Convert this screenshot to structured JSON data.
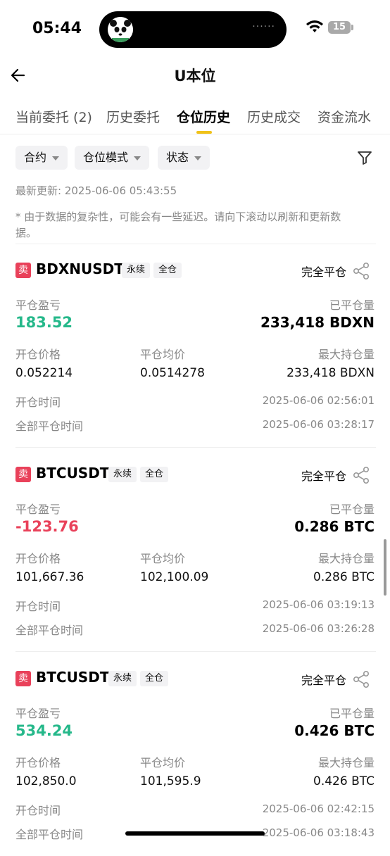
{
  "status_bar": {
    "time": "05:44",
    "battery": "15",
    "dots": "······"
  },
  "header": {
    "title": "U本位"
  },
  "tabs": [
    {
      "label": "当前委托 (2)"
    },
    {
      "label": "历史委托"
    },
    {
      "label": "仓位历史"
    },
    {
      "label": "历史成交"
    },
    {
      "label": "资金流水"
    }
  ],
  "filters": [
    {
      "label": "合约"
    },
    {
      "label": "仓位模式"
    },
    {
      "label": "状态"
    }
  ],
  "last_updated": "最新更新: 2025-06-06 05:43:55",
  "note": "* 由于数据的复杂性，可能会有一些延迟。请向下滚动以刷新和更新数据。",
  "labels": {
    "pnl": "平仓盈亏",
    "closed_qty": "已平仓量",
    "open_price": "开仓价格",
    "avg_close_price": "平仓均价",
    "max_holding": "最大持仓量",
    "open_time": "开仓时间",
    "full_close_time": "全部平仓时间"
  },
  "positions": [
    {
      "side": "卖",
      "symbol": "BDXNUSDT",
      "type": "永续",
      "margin": "全仓",
      "status": "完全平仓",
      "pnl": "183.52",
      "pnl_sign": "positive",
      "closed_qty": "233,418 BDXN",
      "open_price": "0.052214",
      "avg_close_price": "0.0514278",
      "max_holding": "233,418 BDXN",
      "open_time": "2025-06-06 02:56:01",
      "full_close_time": "2025-06-06 03:28:17"
    },
    {
      "side": "卖",
      "symbol": "BTCUSDT",
      "type": "永续",
      "margin": "全仓",
      "status": "完全平仓",
      "pnl": "-123.76",
      "pnl_sign": "negative",
      "closed_qty": "0.286 BTC",
      "open_price": "101,667.36",
      "avg_close_price": "102,100.09",
      "max_holding": "0.286 BTC",
      "open_time": "2025-06-06 03:19:13",
      "full_close_time": "2025-06-06 03:26:28"
    },
    {
      "side": "卖",
      "symbol": "BTCUSDT",
      "type": "永续",
      "margin": "全仓",
      "status": "完全平仓",
      "pnl": "534.24",
      "pnl_sign": "positive",
      "closed_qty": "0.426 BTC",
      "open_price": "102,850.0",
      "avg_close_price": "101,595.9",
      "max_holding": "0.426 BTC",
      "open_time": "2025-06-06 02:42:15",
      "full_close_time": "2025-06-06 03:18:43"
    }
  ],
  "colors": {
    "accent": "#f0c21a",
    "positive": "#25b88a",
    "negative": "#e9415a",
    "sell_badge": "#e9415a"
  },
  "icons": {
    "back": "arrow-left-icon",
    "filter": "funnel-icon",
    "share": "share-icon",
    "wifi": "wifi-icon"
  }
}
